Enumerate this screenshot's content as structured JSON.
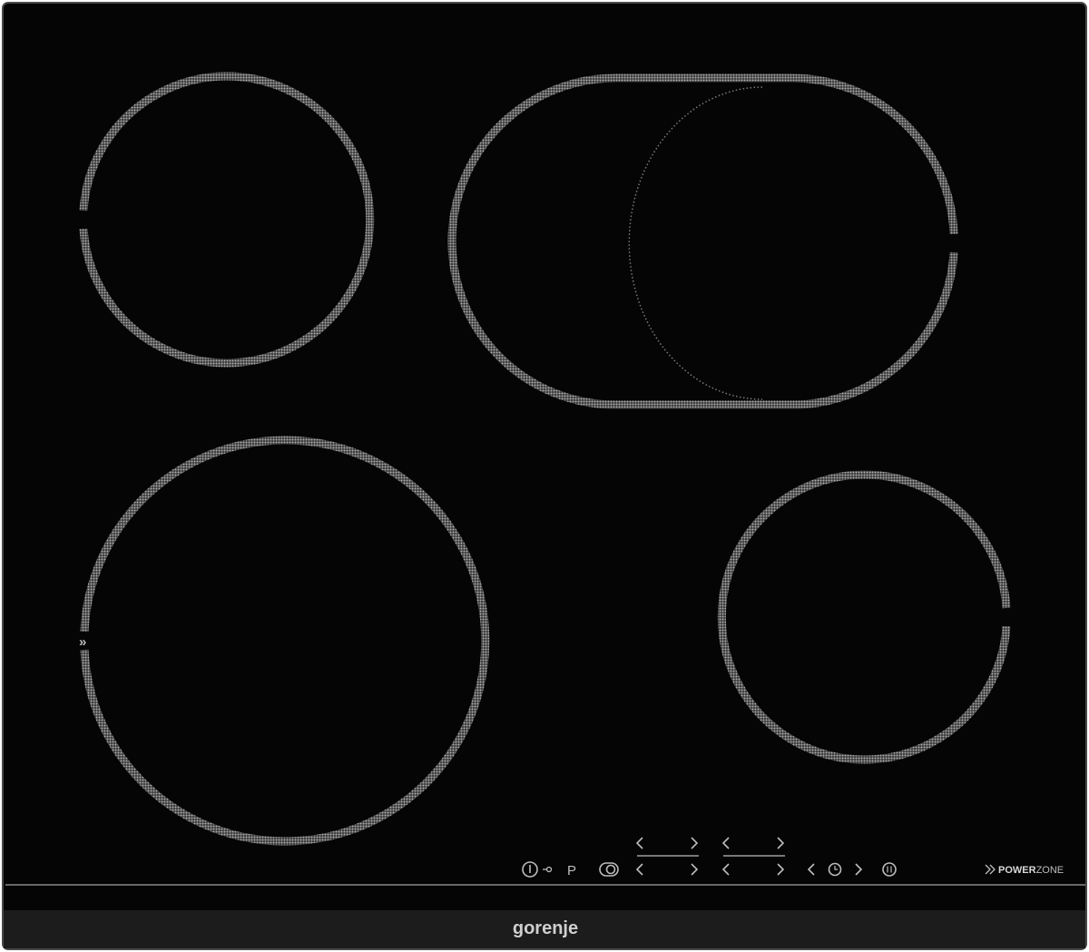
{
  "brand": {
    "logo_text": "gorenje"
  },
  "badge": {
    "power_bold": "POWER",
    "power_rest": "ZONE",
    "icon": "double-chevron-icon"
  },
  "controls": {
    "program_label": "P",
    "power_icon": "power-icon",
    "lock_icon": "key-lock-icon",
    "bridge_icon": "bridge-zone-icon",
    "timer_icon": "clock-icon",
    "pause_icon": "pause-icon",
    "decrease_icon": "chevron-left-icon",
    "increase_icon": "chevron-right-icon"
  },
  "colors": {
    "glass": "#050505",
    "frame": "#1c1c1c",
    "zone_outline": "#8a8a8a",
    "controls": "#bdbdbd"
  }
}
